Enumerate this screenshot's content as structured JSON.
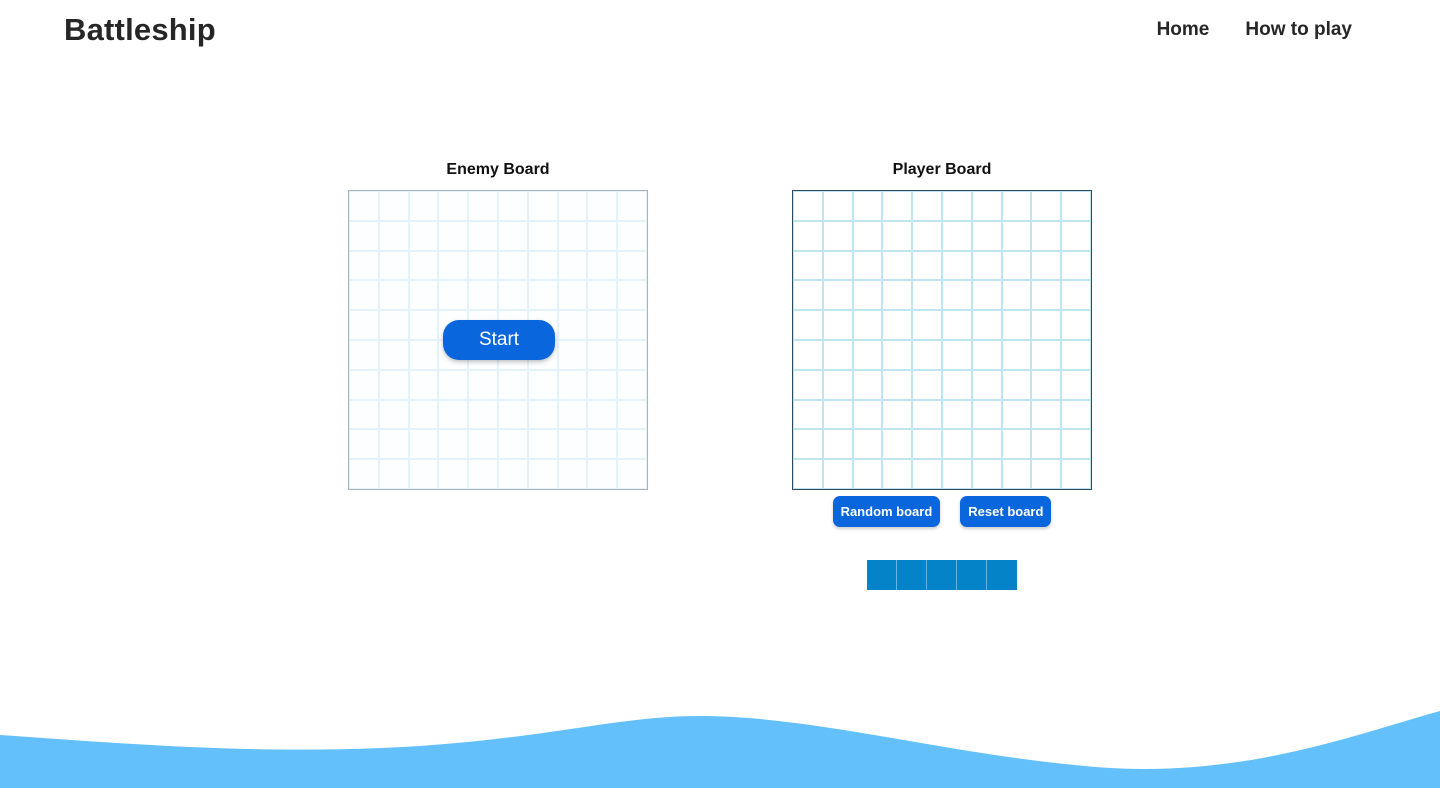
{
  "header": {
    "title": "Battleship",
    "nav": [
      {
        "label": "Home"
      },
      {
        "label": "How to play"
      }
    ]
  },
  "enemy_board": {
    "title": "Enemy Board",
    "rows": 10,
    "cols": 10,
    "start_label": "Start"
  },
  "player_board": {
    "title": "Player Board",
    "rows": 10,
    "cols": 10,
    "random_label": "Random board",
    "reset_label": "Reset board"
  },
  "ship": {
    "length": 5,
    "color": "#0583c8"
  },
  "colors": {
    "accent": "#0a66dc",
    "wave": "#64c0fb"
  }
}
